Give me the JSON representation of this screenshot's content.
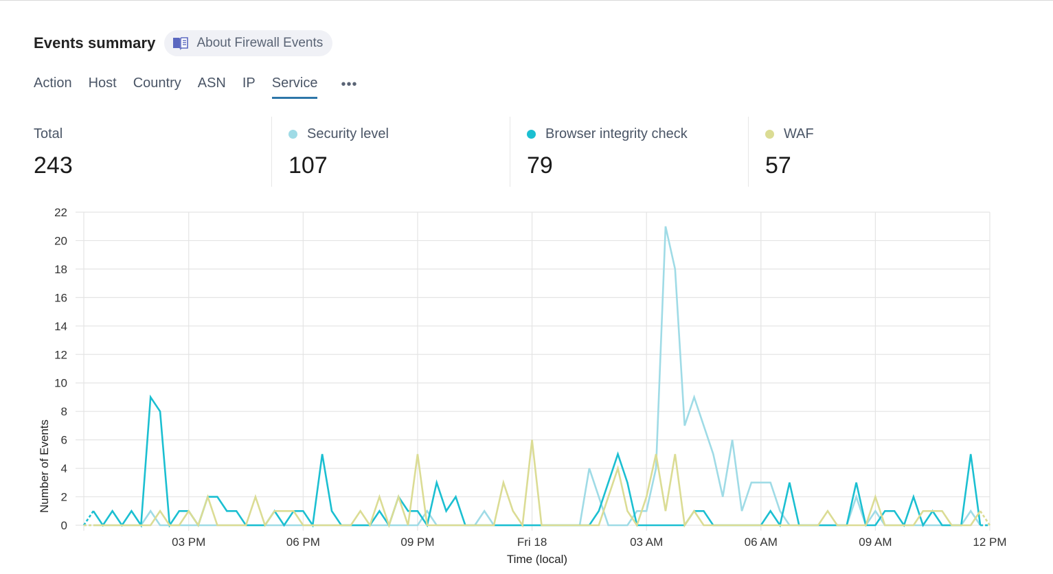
{
  "header": {
    "title": "Events summary",
    "about_label": "About Firewall Events",
    "about_icon": "book-icon"
  },
  "tabs": [
    {
      "label": "Action",
      "active": false
    },
    {
      "label": "Host",
      "active": false
    },
    {
      "label": "Country",
      "active": false
    },
    {
      "label": "ASN",
      "active": false
    },
    {
      "label": "IP",
      "active": false
    },
    {
      "label": "Service",
      "active": true
    }
  ],
  "more_label": "•••",
  "stats": [
    {
      "label": "Total",
      "value": "243",
      "color": null
    },
    {
      "label": "Security level",
      "value": "107",
      "color": "#9fdbe6"
    },
    {
      "label": "Browser integrity check",
      "value": "79",
      "color": "#1bbfd1"
    },
    {
      "label": "WAF",
      "value": "57",
      "color": "#dbdc94"
    }
  ],
  "chart_data": {
    "type": "line",
    "title": "",
    "xlabel": "Time (local)",
    "ylabel": "Number of Events",
    "ylim": [
      0,
      22
    ],
    "yticks": [
      0,
      2,
      4,
      6,
      8,
      10,
      12,
      14,
      16,
      18,
      20,
      22
    ],
    "x_interval_minutes": 15,
    "x_points": 96,
    "xticks": [
      {
        "index": 11,
        "label": "03 PM"
      },
      {
        "index": 23,
        "label": "06 PM"
      },
      {
        "index": 35,
        "label": "09 PM"
      },
      {
        "index": 47,
        "label": "Fri 18"
      },
      {
        "index": 59,
        "label": "03 AM"
      },
      {
        "index": 71,
        "label": "06 AM"
      },
      {
        "index": 83,
        "label": "09 AM"
      },
      {
        "index": 95,
        "label": "12 PM"
      }
    ],
    "grid": true,
    "legend": "none",
    "series": [
      {
        "name": "Security level",
        "color": "#9fdbe6",
        "values": [
          0,
          0,
          0,
          0,
          0,
          0,
          0,
          1,
          0,
          0,
          0,
          0,
          0,
          0,
          0,
          0,
          0,
          0,
          0,
          0,
          0,
          0,
          0,
          0,
          0,
          0,
          0,
          0,
          0,
          0,
          0,
          0,
          0,
          0,
          0,
          0,
          1,
          0,
          0,
          0,
          0,
          0,
          1,
          0,
          0,
          0,
          0,
          0,
          0,
          0,
          0,
          0,
          0,
          4,
          2,
          0,
          0,
          0,
          1,
          1,
          4,
          21,
          18,
          7,
          9,
          7,
          5,
          2,
          6,
          1,
          3,
          3,
          3,
          1,
          0,
          0,
          0,
          0,
          0,
          0,
          0,
          2,
          0,
          1,
          0,
          0,
          0,
          0,
          0,
          0,
          0,
          0,
          0,
          1,
          0,
          0
        ]
      },
      {
        "name": "Browser integrity check",
        "color": "#1bbfd1",
        "values": [
          0,
          1,
          0,
          1,
          0,
          1,
          0,
          9,
          8,
          0,
          1,
          1,
          0,
          2,
          2,
          1,
          1,
          0,
          0,
          0,
          1,
          0,
          1,
          1,
          0,
          5,
          1,
          0,
          0,
          0,
          0,
          1,
          0,
          2,
          1,
          1,
          0,
          3,
          1,
          2,
          0,
          0,
          0,
          0,
          0,
          0,
          0,
          0,
          0,
          0,
          0,
          0,
          0,
          0,
          1,
          3,
          5,
          3,
          0,
          0,
          0,
          0,
          0,
          0,
          1,
          1,
          0,
          0,
          0,
          0,
          0,
          0,
          1,
          0,
          3,
          0,
          0,
          0,
          0,
          0,
          0,
          3,
          0,
          0,
          1,
          1,
          0,
          2,
          0,
          1,
          0,
          0,
          0,
          5,
          0,
          0
        ]
      },
      {
        "name": "WAF",
        "color": "#dbdc94",
        "values": [
          0,
          0,
          0,
          0,
          0,
          0,
          0,
          0,
          1,
          0,
          0,
          1,
          0,
          2,
          0,
          0,
          0,
          0,
          2,
          0,
          1,
          1,
          1,
          0,
          0,
          0,
          0,
          0,
          0,
          1,
          0,
          2,
          0,
          2,
          0,
          5,
          0,
          0,
          0,
          0,
          0,
          0,
          0,
          0,
          3,
          1,
          0,
          6,
          0,
          0,
          0,
          0,
          0,
          0,
          0,
          2,
          4,
          1,
          0,
          2,
          5,
          1,
          5,
          0,
          1,
          0,
          0,
          0,
          0,
          0,
          0,
          0,
          0,
          0,
          0,
          0,
          0,
          0,
          1,
          0,
          0,
          0,
          0,
          2,
          0,
          0,
          0,
          0,
          1,
          1,
          1,
          0,
          0,
          0,
          1,
          0
        ]
      }
    ]
  }
}
